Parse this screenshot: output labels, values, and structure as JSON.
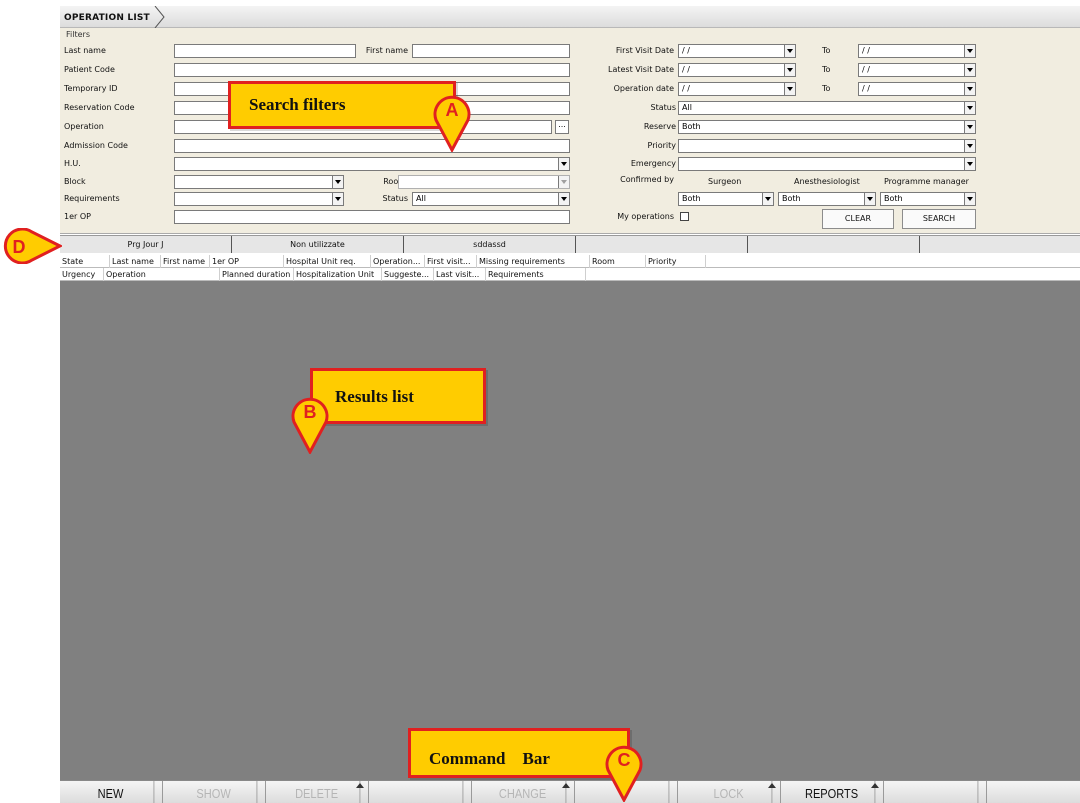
{
  "header": {
    "title": "OPERATION LIST"
  },
  "filters": {
    "legend": "Filters",
    "labels": {
      "last_name": "Last name",
      "first_name": "First name",
      "patient_code": "Patient Code",
      "temporary_id": "Temporary ID",
      "reservation_code": "Reservation Code",
      "operation": "Operation",
      "admission_code": "Admission Code",
      "hu": "H.U.",
      "block": "Block",
      "room": "Room",
      "requirements": "Requirements",
      "status": "Status",
      "first_op": "1er OP",
      "first_visit_date": "First Visit Date",
      "latest_visit_date": "Latest Visit Date",
      "operation_date": "Operation date",
      "to": "To",
      "status_right": "Status",
      "reserve": "Reserve",
      "priority": "Priority",
      "emergency": "Emergency",
      "confirmed_by": "Confirmed by",
      "surgeon": "Surgeon",
      "anesthesiologist": "Anesthesiologist",
      "programme_manager": "Programme manager",
      "my_operations": "My operations"
    },
    "values": {
      "date_placeholder": "  /    /",
      "ellipsis": "...",
      "status_left": "All",
      "status_right": "All",
      "reserve": "Both",
      "surgeon": "Both",
      "anesthesiologist": "Both",
      "programme_manager": "Both"
    },
    "buttons": {
      "clear": "CLEAR",
      "search": "SEARCH"
    }
  },
  "tabs": [
    "Prg Jour J",
    "Non utilizzate",
    "sddassd",
    "",
    "",
    ""
  ],
  "columns_row1": [
    "State",
    "Last name",
    "First name",
    "1er OP",
    "Hospital Unit req.",
    "Operation...",
    "First visit...",
    "Missing requirements",
    "Room",
    "Priority"
  ],
  "columns_row2": [
    "Urgency",
    "Operation",
    "Planned duration",
    "Hospitalization Unit",
    "Suggeste...",
    "Last visit...",
    "Requirements"
  ],
  "command_bar": [
    "NEW",
    "SHOW",
    "DELETE",
    "",
    "CHANGE",
    "",
    "LOCK",
    "REPORTS",
    ""
  ],
  "annotations": {
    "a_label": "Search filters",
    "a_letter": "A",
    "b_label": "Results list",
    "b_letter": "B",
    "c_label": "Command    Bar",
    "c_letter": "C",
    "d_letter": "D"
  },
  "colors": {
    "callout_fill": "#ffcc00",
    "callout_border": "#e02020",
    "results_bg": "#808080",
    "filters_bg": "#f1ede0"
  }
}
